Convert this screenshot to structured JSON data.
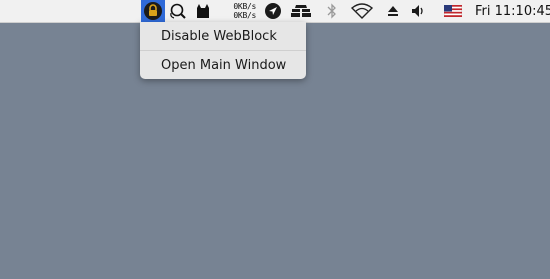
{
  "menubar": {
    "netspeed": {
      "upload": "0KB/s",
      "download": "0KB/s"
    },
    "clock": "Fri 11:10:45",
    "icons": [
      "webblock-lock-icon",
      "search-magnifier-icon",
      "cat-icon",
      "network-speed-meter",
      "send-arrow-icon",
      "mosaic-grid-icon",
      "bluetooth-icon",
      "wifi-icon",
      "eject-icon",
      "volume-icon",
      "us-flag-input-source-icon"
    ]
  },
  "menu": {
    "items": [
      {
        "label": "Disable WebBlock"
      },
      {
        "label": "Open Main Window"
      }
    ]
  },
  "colors": {
    "desktop": "#778393",
    "menubar": "#f1f1f1",
    "highlight": "#2f6ad8",
    "menu_bg": "#e6e6e6"
  }
}
